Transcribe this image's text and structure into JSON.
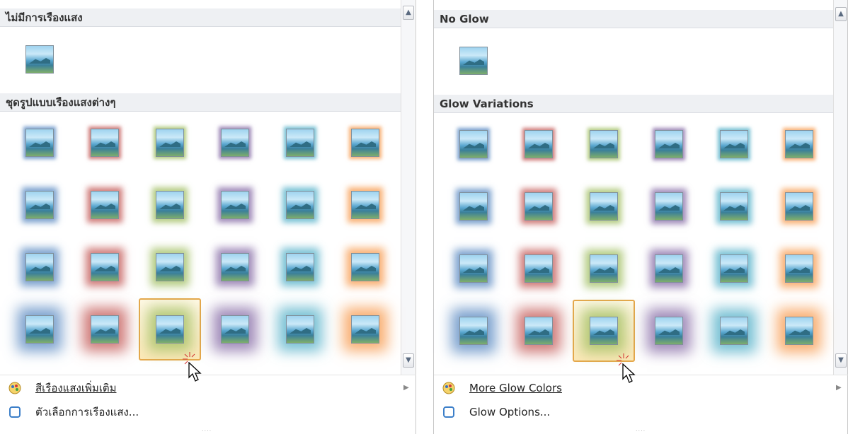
{
  "left_panel": {
    "no_glow_header": "ไม่มีการเรืองแสง",
    "variations_header": "ชุดรูปแบบเรืองแสงต่างๆ",
    "more_colors": "สีเรืองแสงเพิ่มเติม",
    "options": "ตัวเลือกการเรืองแสง..."
  },
  "right_panel": {
    "no_glow_header": "No Glow",
    "variations_header": "Glow Variations",
    "more_colors": "More Glow Colors",
    "options": "Glow Options..."
  },
  "glow_colors": [
    "#4f81bd",
    "#c0504d",
    "#9bbb59",
    "#8064a2",
    "#4bacc6",
    "#f79646"
  ],
  "glow_sizes": [
    5,
    8,
    11,
    18
  ],
  "selected": {
    "row": 4,
    "col": 3
  },
  "icons": {
    "scroll_up": "scroll-up-arrow-icon",
    "scroll_down": "scroll-down-arrow-icon",
    "palette": "palette-icon",
    "options": "glow-options-icon",
    "submenu": "submenu-arrow-icon",
    "cursor": "mouse-pointer-icon"
  }
}
